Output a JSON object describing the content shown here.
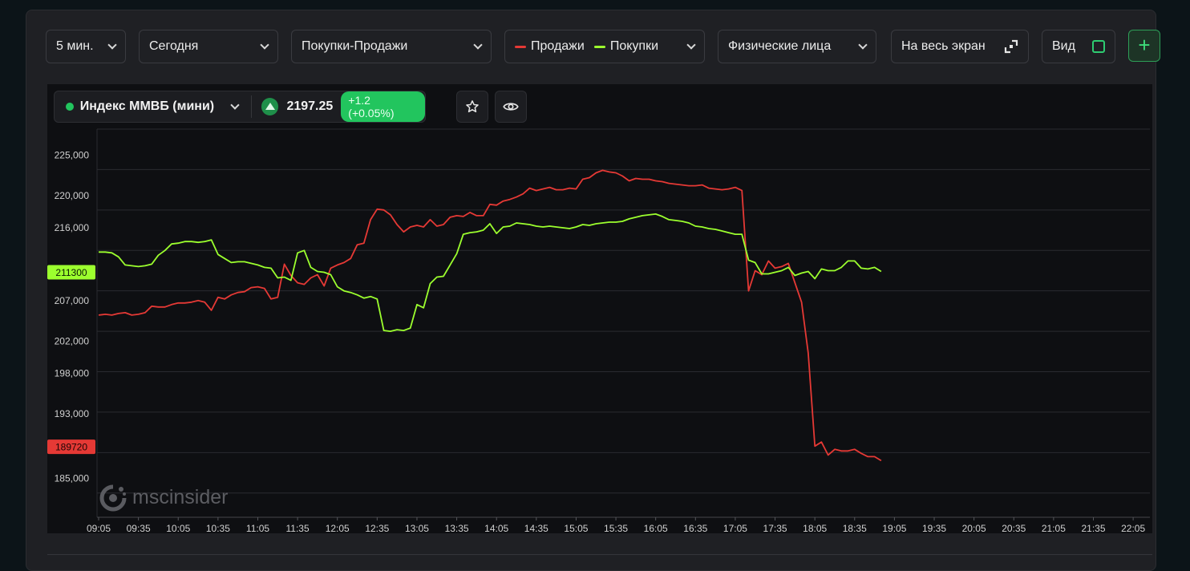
{
  "toolbar": {
    "interval": "5 мин.",
    "period": "Сегодня",
    "mode": "Покупки-Продажи",
    "legend_sell": "Продажи",
    "legend_buy": "Покупки",
    "group": "Физические лица",
    "fullscreen": "На весь экран",
    "view": "Вид"
  },
  "instrument": {
    "name": "Индекс ММВБ (мини)",
    "price": "2197.25",
    "change": "+1.2 (+0.05%)"
  },
  "watermark": "mscinsider",
  "colors": {
    "sell": "#e53935",
    "buy": "#9cff2e",
    "accent": "#22c55e"
  },
  "chart_data": {
    "type": "line",
    "ylim": [
      181000,
      229000
    ],
    "yticks": [
      {
        "label": "225,000",
        "value": 225000
      },
      {
        "label": "220,000",
        "value": 220000
      },
      {
        "label": "216,000",
        "value": 216000
      },
      {
        "label": "207,000",
        "value": 207000
      },
      {
        "label": "202,000",
        "value": 202000
      },
      {
        "label": "198,000",
        "value": 198000
      },
      {
        "label": "193,000",
        "value": 193000
      },
      {
        "label": "185,000",
        "value": 185000
      }
    ],
    "gridlines": [
      229000,
      224000,
      219000,
      214000,
      209000,
      204000,
      199000,
      194000,
      189000,
      184000
    ],
    "xticks": [
      "09:05",
      "09:35",
      "10:05",
      "10:35",
      "11:05",
      "11:35",
      "12:05",
      "12:35",
      "13:05",
      "13:35",
      "14:05",
      "14:35",
      "15:05",
      "15:35",
      "16:05",
      "16:35",
      "17:05",
      "17:35",
      "18:05",
      "18:35",
      "19:05",
      "19:35",
      "20:05",
      "20:35",
      "21:05",
      "21:35",
      "22:05"
    ],
    "x_start": "09:05",
    "x_step_minutes": 5,
    "last_labels": {
      "buy": "211300",
      "sell": "189720"
    },
    "series": [
      {
        "name": "Продажи",
        "values": [
          206000,
          206100,
          206000,
          206200,
          206300,
          206000,
          206100,
          206300,
          207100,
          207000,
          207000,
          207300,
          207500,
          207500,
          207600,
          207800,
          207600,
          206600,
          208200,
          208000,
          208500,
          208800,
          208900,
          209400,
          209500,
          209300,
          208000,
          208200,
          212300,
          210900,
          210000,
          209800,
          210600,
          211000,
          209600,
          211800,
          212200,
          212500,
          213000,
          214700,
          214900,
          217800,
          219100,
          219000,
          218400,
          217200,
          216300,
          216900,
          217100,
          216900,
          217800,
          217000,
          217200,
          218100,
          218300,
          218200,
          218700,
          218300,
          218300,
          219700,
          219600,
          220100,
          220300,
          220600,
          221000,
          221700,
          221400,
          221600,
          221800,
          221500,
          221500,
          221700,
          221600,
          222800,
          223000,
          223600,
          223900,
          223700,
          223600,
          223200,
          222600,
          222900,
          222800,
          222800,
          222600,
          222500,
          222300,
          222200,
          222100,
          222000,
          222000,
          222100,
          221700,
          221600,
          221500,
          221600,
          221800,
          221400,
          209000,
          211500,
          211000,
          212700,
          211800,
          212000,
          212400,
          210000,
          207600,
          201300,
          189800,
          190300,
          188700,
          189400,
          189200,
          189200,
          189400,
          188900,
          188500,
          188500,
          188000
        ]
      },
      {
        "name": "Покупки",
        "values": [
          213800,
          213800,
          213700,
          213200,
          212200,
          212100,
          212000,
          212100,
          212300,
          213400,
          214000,
          214800,
          214900,
          215100,
          215100,
          215000,
          215100,
          215300,
          213500,
          213000,
          212500,
          212600,
          212600,
          212400,
          212200,
          211900,
          211800,
          210600,
          210700,
          210300,
          213700,
          214000,
          211900,
          211400,
          211300,
          211000,
          209500,
          209000,
          208800,
          208500,
          208100,
          208300,
          208000,
          204100,
          204000,
          204200,
          204100,
          204400,
          207300,
          206900,
          209900,
          210700,
          210800,
          212200,
          213600,
          216000,
          216200,
          216300,
          216500,
          217300,
          216100,
          216900,
          217000,
          217400,
          217300,
          217200,
          217000,
          216900,
          217000,
          216900,
          216800,
          216700,
          216900,
          217200,
          217100,
          217300,
          217400,
          217500,
          217500,
          217600,
          217900,
          218100,
          218300,
          218400,
          218500,
          218200,
          217800,
          217700,
          217600,
          217400,
          217000,
          216900,
          216700,
          216600,
          216400,
          216200,
          216000,
          216000,
          212800,
          212500,
          211100,
          211100,
          211300,
          211500,
          211900,
          210900,
          211200,
          211400,
          210500,
          211700,
          211500,
          211500,
          211900,
          212700,
          212700,
          211800,
          211700,
          211900,
          211400
        ]
      }
    ]
  }
}
